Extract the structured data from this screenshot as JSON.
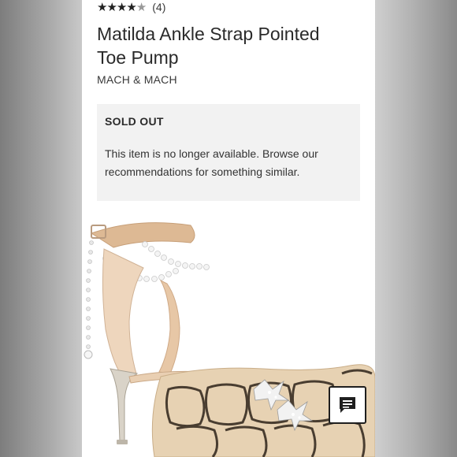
{
  "product": {
    "rating": {
      "value": 4.5,
      "max": 5,
      "review_count": "(4)"
    },
    "title": "Matilda Ankle Strap Pointed Toe Pump",
    "brand": "MACH & MACH"
  },
  "availability": {
    "status": "SOLD OUT",
    "message": "This item is no longer available. Browse our recommendations for something similar."
  },
  "image": {
    "subject": "shoe"
  },
  "chat": {
    "icon": "chat-icon"
  },
  "colors": {
    "page_bg": "#ffffff",
    "notice_bg": "#f2f2f2",
    "text": "#2a2a2a",
    "border": "#1f1f1f"
  }
}
